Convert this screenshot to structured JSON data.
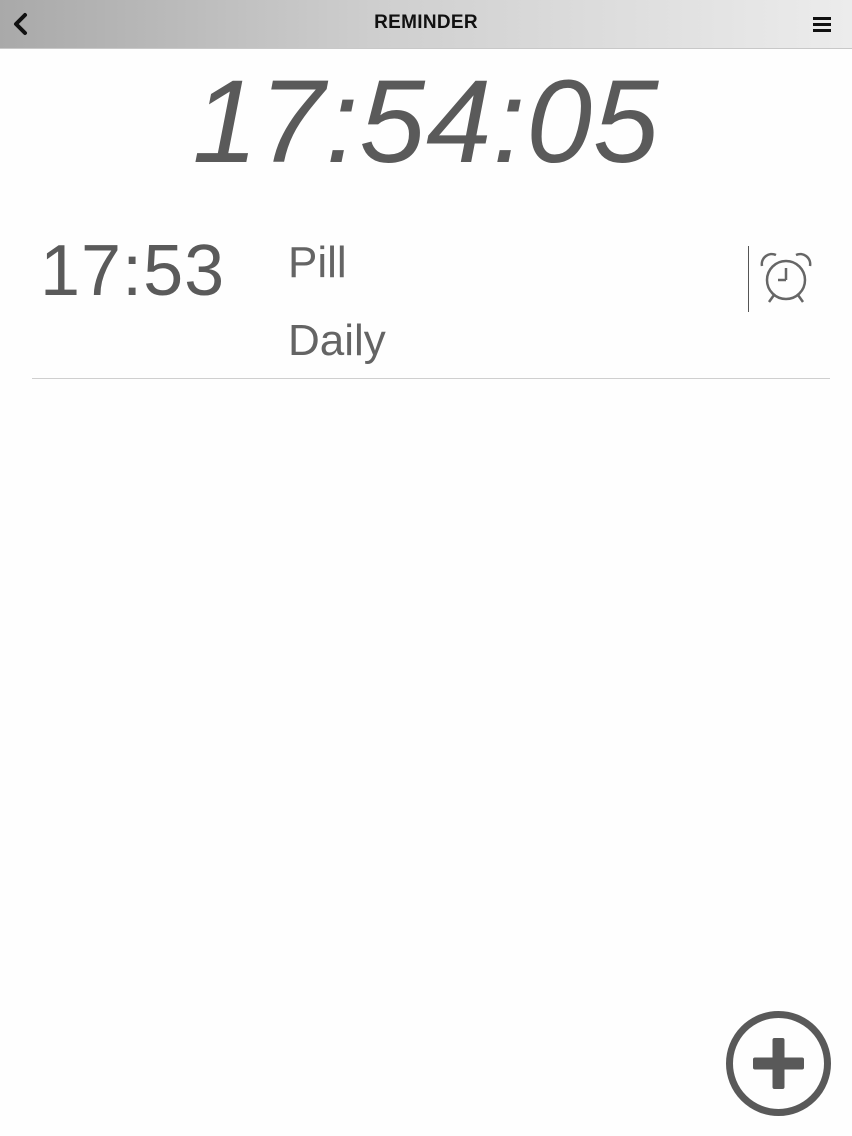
{
  "header": {
    "title": "REMINDER",
    "back_icon": "chevron-left-icon",
    "menu_icon": "hamburger-menu-icon"
  },
  "clock": {
    "time": "17:54:05"
  },
  "reminders": [
    {
      "time": "17:53",
      "name": "Pill",
      "repeat": "Daily",
      "icon": "alarm-clock-icon"
    }
  ],
  "add_button": {
    "icon": "plus-circle-icon"
  },
  "colors": {
    "text": "#5f5f5f",
    "header_gradient_start": "#a9a9a9",
    "header_gradient_end": "#ececec",
    "background": "#fefefe"
  }
}
